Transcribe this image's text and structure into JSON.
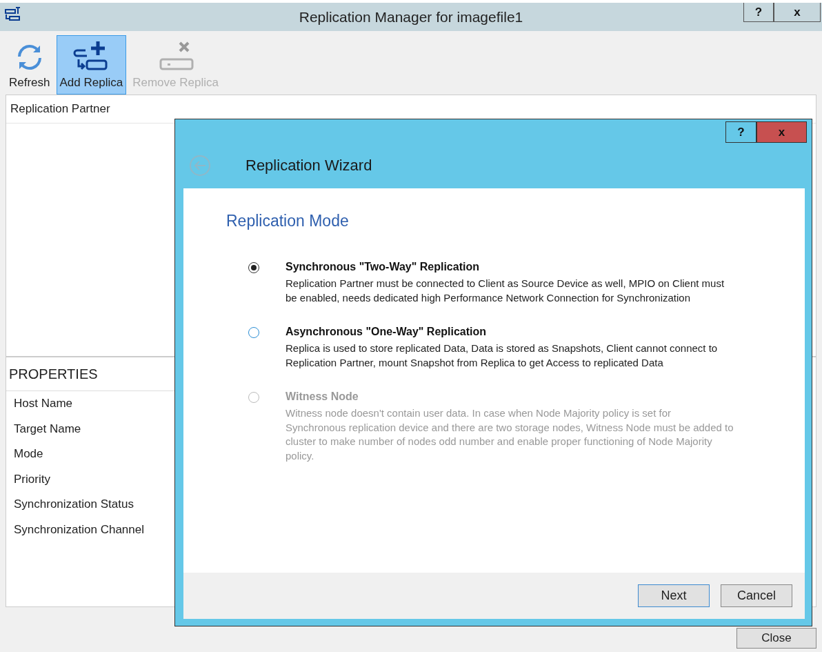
{
  "window": {
    "title": "Replication Manager for imagefile1",
    "help": "?",
    "close": "x"
  },
  "toolbar": [
    {
      "kind": "refresh",
      "label": "Refresh",
      "selected": false,
      "disabled": false
    },
    {
      "kind": "add",
      "label": "Add Replica",
      "selected": true,
      "disabled": false
    },
    {
      "kind": "remove",
      "label": "Remove Replica",
      "selected": false,
      "disabled": true
    }
  ],
  "partners": {
    "column": "Replication Partner"
  },
  "properties": {
    "title": "PROPERTIES",
    "items": [
      "Host Name",
      "Target Name",
      "Mode",
      "Priority",
      "Synchronization Status",
      "Synchronization Channel"
    ]
  },
  "close_button": "Close",
  "dialog": {
    "help": "?",
    "close": "x",
    "title": "Replication Wizard",
    "heading": "Replication Mode",
    "options": [
      {
        "title": "Synchronous \"Two-Way\" Replication",
        "description": "Replication Partner must be connected to Client as Source Device as well, MPIO on Client must be enabled, needs dedicated high Performance Network Connection for Synchronization",
        "selected": true,
        "disabled": false
      },
      {
        "title": "Asynchronous \"One-Way\" Replication",
        "description": "Replica is used to store replicated Data, Data is stored as Snapshots, Client cannot connect to Replication Partner, mount Snapshot from Replica to get Access to replicated Data",
        "selected": false,
        "disabled": false
      },
      {
        "title": "Witness Node",
        "description": "Witness node doesn't contain user data. In case when Node Majority policy is set for Synchronous replication device and there are two storage nodes, Witness Node must be added to cluster to make number of nodes odd number and enable proper functioning of Node Majority policy.",
        "selected": false,
        "disabled": true
      }
    ],
    "buttons": [
      {
        "label": "Next",
        "selected": true
      },
      {
        "label": "Cancel",
        "selected": false
      }
    ]
  }
}
